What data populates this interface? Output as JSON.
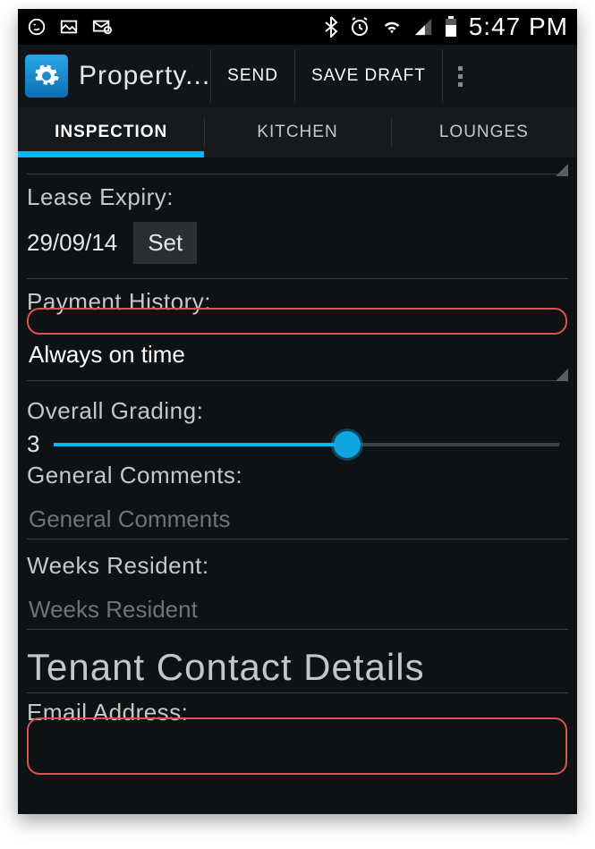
{
  "statusbar": {
    "clock": "5:47 PM"
  },
  "actionbar": {
    "title": "Property...",
    "send": "SEND",
    "save_draft": "SAVE DRAFT"
  },
  "tabs": {
    "inspection": "INSPECTION",
    "kitchen": "KITCHEN",
    "lounges": "LOUNGES"
  },
  "form": {
    "lease_expiry_label": "Lease Expiry:",
    "lease_expiry_value": "29/09/14",
    "set_button": "Set",
    "payment_history_label": "Payment History:",
    "payment_history_value": "Always on time",
    "overall_grading_label": "Overall Grading:",
    "overall_grading_value": "3",
    "general_comments_label": "General Comments:",
    "general_comments_placeholder": "General Comments",
    "weeks_resident_label": "Weeks Resident:",
    "weeks_resident_placeholder": "Weeks Resident",
    "tenant_contact_header": "Tenant Contact Details",
    "email_address_label": "Email Address:"
  }
}
